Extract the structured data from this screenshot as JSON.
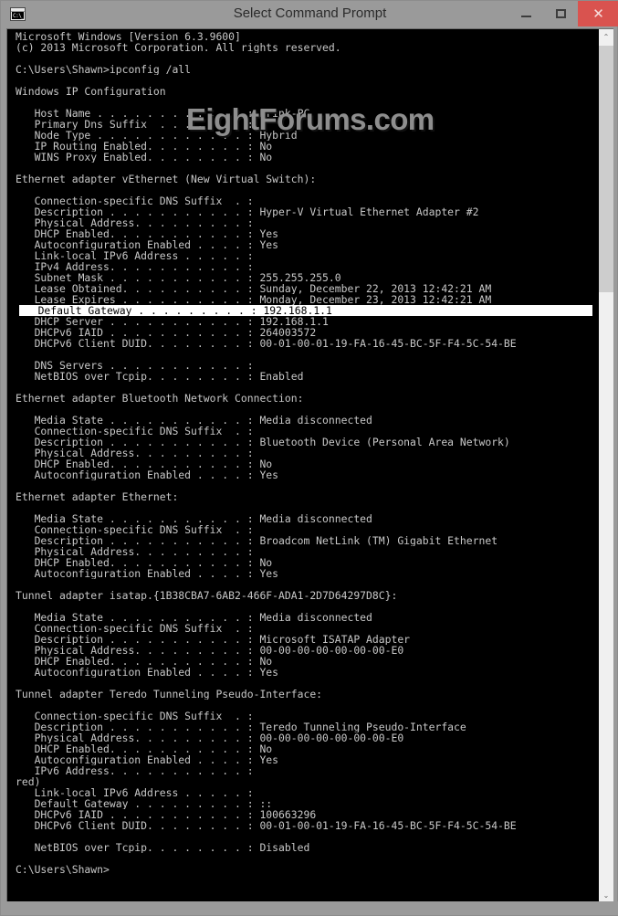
{
  "window": {
    "title": "Select Command Prompt",
    "icon": "command-prompt-icon",
    "icon_glyph": "C:\\_",
    "minimize_label": "",
    "maximize_label": "",
    "close_label": "✕",
    "close_color": "#d9534f",
    "frame_color": "#9a9a9a"
  },
  "watermark": {
    "text": "EightForums.com",
    "color": "#8e8e8e"
  },
  "scrollbar": {
    "up_arrow": "⌃",
    "down_arrow": "⌄"
  },
  "console": {
    "background": "#000000",
    "foreground": "#c8c8c8",
    "selection_background": "#ffffff",
    "selection_foreground": "#000000",
    "prompt": "C:\\Users\\Shawn>",
    "command": "ipconfig /all",
    "cursor": "_",
    "lines": [
      {
        "text": "Microsoft Windows [Version 6.3.9600]",
        "selected": false
      },
      {
        "text": "(c) 2013 Microsoft Corporation. All rights reserved.",
        "selected": false
      },
      {
        "text": "",
        "selected": false
      },
      {
        "text": "C:\\Users\\Shawn>ipconfig /all",
        "selected": false
      },
      {
        "text": "",
        "selected": false
      },
      {
        "text": "Windows IP Configuration",
        "selected": false
      },
      {
        "text": "",
        "selected": false
      },
      {
        "text": "   Host Name . . . . . . . . . . . . : Brink-PC",
        "selected": false
      },
      {
        "text": "   Primary Dns Suffix  . . . . . . . :",
        "selected": false
      },
      {
        "text": "   Node Type . . . . . . . . . . . . : Hybrid",
        "selected": false
      },
      {
        "text": "   IP Routing Enabled. . . . . . . . : No",
        "selected": false
      },
      {
        "text": "   WINS Proxy Enabled. . . . . . . . : No",
        "selected": false
      },
      {
        "text": "",
        "selected": false
      },
      {
        "text": "Ethernet adapter vEthernet (New Virtual Switch):",
        "selected": false
      },
      {
        "text": "",
        "selected": false
      },
      {
        "text": "   Connection-specific DNS Suffix  . :",
        "selected": false
      },
      {
        "text": "   Description . . . . . . . . . . . : Hyper-V Virtual Ethernet Adapter #2",
        "selected": false
      },
      {
        "text": "   Physical Address. . . . . . . . . :",
        "selected": false
      },
      {
        "text": "   DHCP Enabled. . . . . . . . . . . : Yes",
        "selected": false
      },
      {
        "text": "   Autoconfiguration Enabled . . . . : Yes",
        "selected": false
      },
      {
        "text": "   Link-local IPv6 Address . . . . . :",
        "selected": false
      },
      {
        "text": "   IPv4 Address. . . . . . . . . . . :",
        "selected": false
      },
      {
        "text": "   Subnet Mask . . . . . . . . . . . : 255.255.255.0",
        "selected": false
      },
      {
        "text": "   Lease Obtained. . . . . . . . . . : Sunday, December 22, 2013 12:42:21 AM",
        "selected": false
      },
      {
        "text": "   Lease Expires . . . . . . . . . . : Monday, December 23, 2013 12:42:21 AM",
        "selected": false
      },
      {
        "text": "   Default Gateway . . . . . . . . . : 192.168.1.1",
        "selected": true
      },
      {
        "text": "   DHCP Server . . . . . . . . . . . : 192.168.1.1",
        "selected": false
      },
      {
        "text": "   DHCPv6 IAID . . . . . . . . . . . : 264003572",
        "selected": false
      },
      {
        "text": "   DHCPv6 Client DUID. . . . . . . . : 00-01-00-01-19-FA-16-45-BC-5F-F4-5C-54-BE",
        "selected": false
      },
      {
        "text": "",
        "selected": false
      },
      {
        "text": "   DNS Servers . . . . . . . . . . . :",
        "selected": false
      },
      {
        "text": "   NetBIOS over Tcpip. . . . . . . . : Enabled",
        "selected": false
      },
      {
        "text": "",
        "selected": false
      },
      {
        "text": "Ethernet adapter Bluetooth Network Connection:",
        "selected": false
      },
      {
        "text": "",
        "selected": false
      },
      {
        "text": "   Media State . . . . . . . . . . . : Media disconnected",
        "selected": false
      },
      {
        "text": "   Connection-specific DNS Suffix  . :",
        "selected": false
      },
      {
        "text": "   Description . . . . . . . . . . . : Bluetooth Device (Personal Area Network)",
        "selected": false
      },
      {
        "text": "   Physical Address. . . . . . . . . :",
        "selected": false
      },
      {
        "text": "   DHCP Enabled. . . . . . . . . . . : No",
        "selected": false
      },
      {
        "text": "   Autoconfiguration Enabled . . . . : Yes",
        "selected": false
      },
      {
        "text": "",
        "selected": false
      },
      {
        "text": "Ethernet adapter Ethernet:",
        "selected": false
      },
      {
        "text": "",
        "selected": false
      },
      {
        "text": "   Media State . . . . . . . . . . . : Media disconnected",
        "selected": false
      },
      {
        "text": "   Connection-specific DNS Suffix  . :",
        "selected": false
      },
      {
        "text": "   Description . . . . . . . . . . . : Broadcom NetLink (TM) Gigabit Ethernet",
        "selected": false
      },
      {
        "text": "   Physical Address. . . . . . . . . :",
        "selected": false
      },
      {
        "text": "   DHCP Enabled. . . . . . . . . . . : No",
        "selected": false
      },
      {
        "text": "   Autoconfiguration Enabled . . . . : Yes",
        "selected": false
      },
      {
        "text": "",
        "selected": false
      },
      {
        "text": "Tunnel adapter isatap.{1B38CBA7-6AB2-466F-ADA1-2D7D64297D8C}:",
        "selected": false
      },
      {
        "text": "",
        "selected": false
      },
      {
        "text": "   Media State . . . . . . . . . . . : Media disconnected",
        "selected": false
      },
      {
        "text": "   Connection-specific DNS Suffix  . :",
        "selected": false
      },
      {
        "text": "   Description . . . . . . . . . . . : Microsoft ISATAP Adapter",
        "selected": false
      },
      {
        "text": "   Physical Address. . . . . . . . . : 00-00-00-00-00-00-00-E0",
        "selected": false
      },
      {
        "text": "   DHCP Enabled. . . . . . . . . . . : No",
        "selected": false
      },
      {
        "text": "   Autoconfiguration Enabled . . . . : Yes",
        "selected": false
      },
      {
        "text": "",
        "selected": false
      },
      {
        "text": "Tunnel adapter Teredo Tunneling Pseudo-Interface:",
        "selected": false
      },
      {
        "text": "",
        "selected": false
      },
      {
        "text": "   Connection-specific DNS Suffix  . :",
        "selected": false
      },
      {
        "text": "   Description . . . . . . . . . . . : Teredo Tunneling Pseudo-Interface",
        "selected": false
      },
      {
        "text": "   Physical Address. . . . . . . . . : 00-00-00-00-00-00-00-E0",
        "selected": false
      },
      {
        "text": "   DHCP Enabled. . . . . . . . . . . : No",
        "selected": false
      },
      {
        "text": "   Autoconfiguration Enabled . . . . : Yes",
        "selected": false
      },
      {
        "text": "   IPv6 Address. . . . . . . . . . . :",
        "selected": false
      },
      {
        "text": "red)",
        "selected": false
      },
      {
        "text": "   Link-local IPv6 Address . . . . . :",
        "selected": false
      },
      {
        "text": "   Default Gateway . . . . . . . . . : ::",
        "selected": false
      },
      {
        "text": "   DHCPv6 IAID . . . . . . . . . . . : 100663296",
        "selected": false
      },
      {
        "text": "   DHCPv6 Client DUID. . . . . . . . : 00-01-00-01-19-FA-16-45-BC-5F-F4-5C-54-BE",
        "selected": false
      },
      {
        "text": "",
        "selected": false
      },
      {
        "text": "   NetBIOS over Tcpip. . . . . . . . : Disabled",
        "selected": false
      },
      {
        "text": "",
        "selected": false
      },
      {
        "text": "C:\\Users\\Shawn>_",
        "selected": false
      }
    ]
  }
}
